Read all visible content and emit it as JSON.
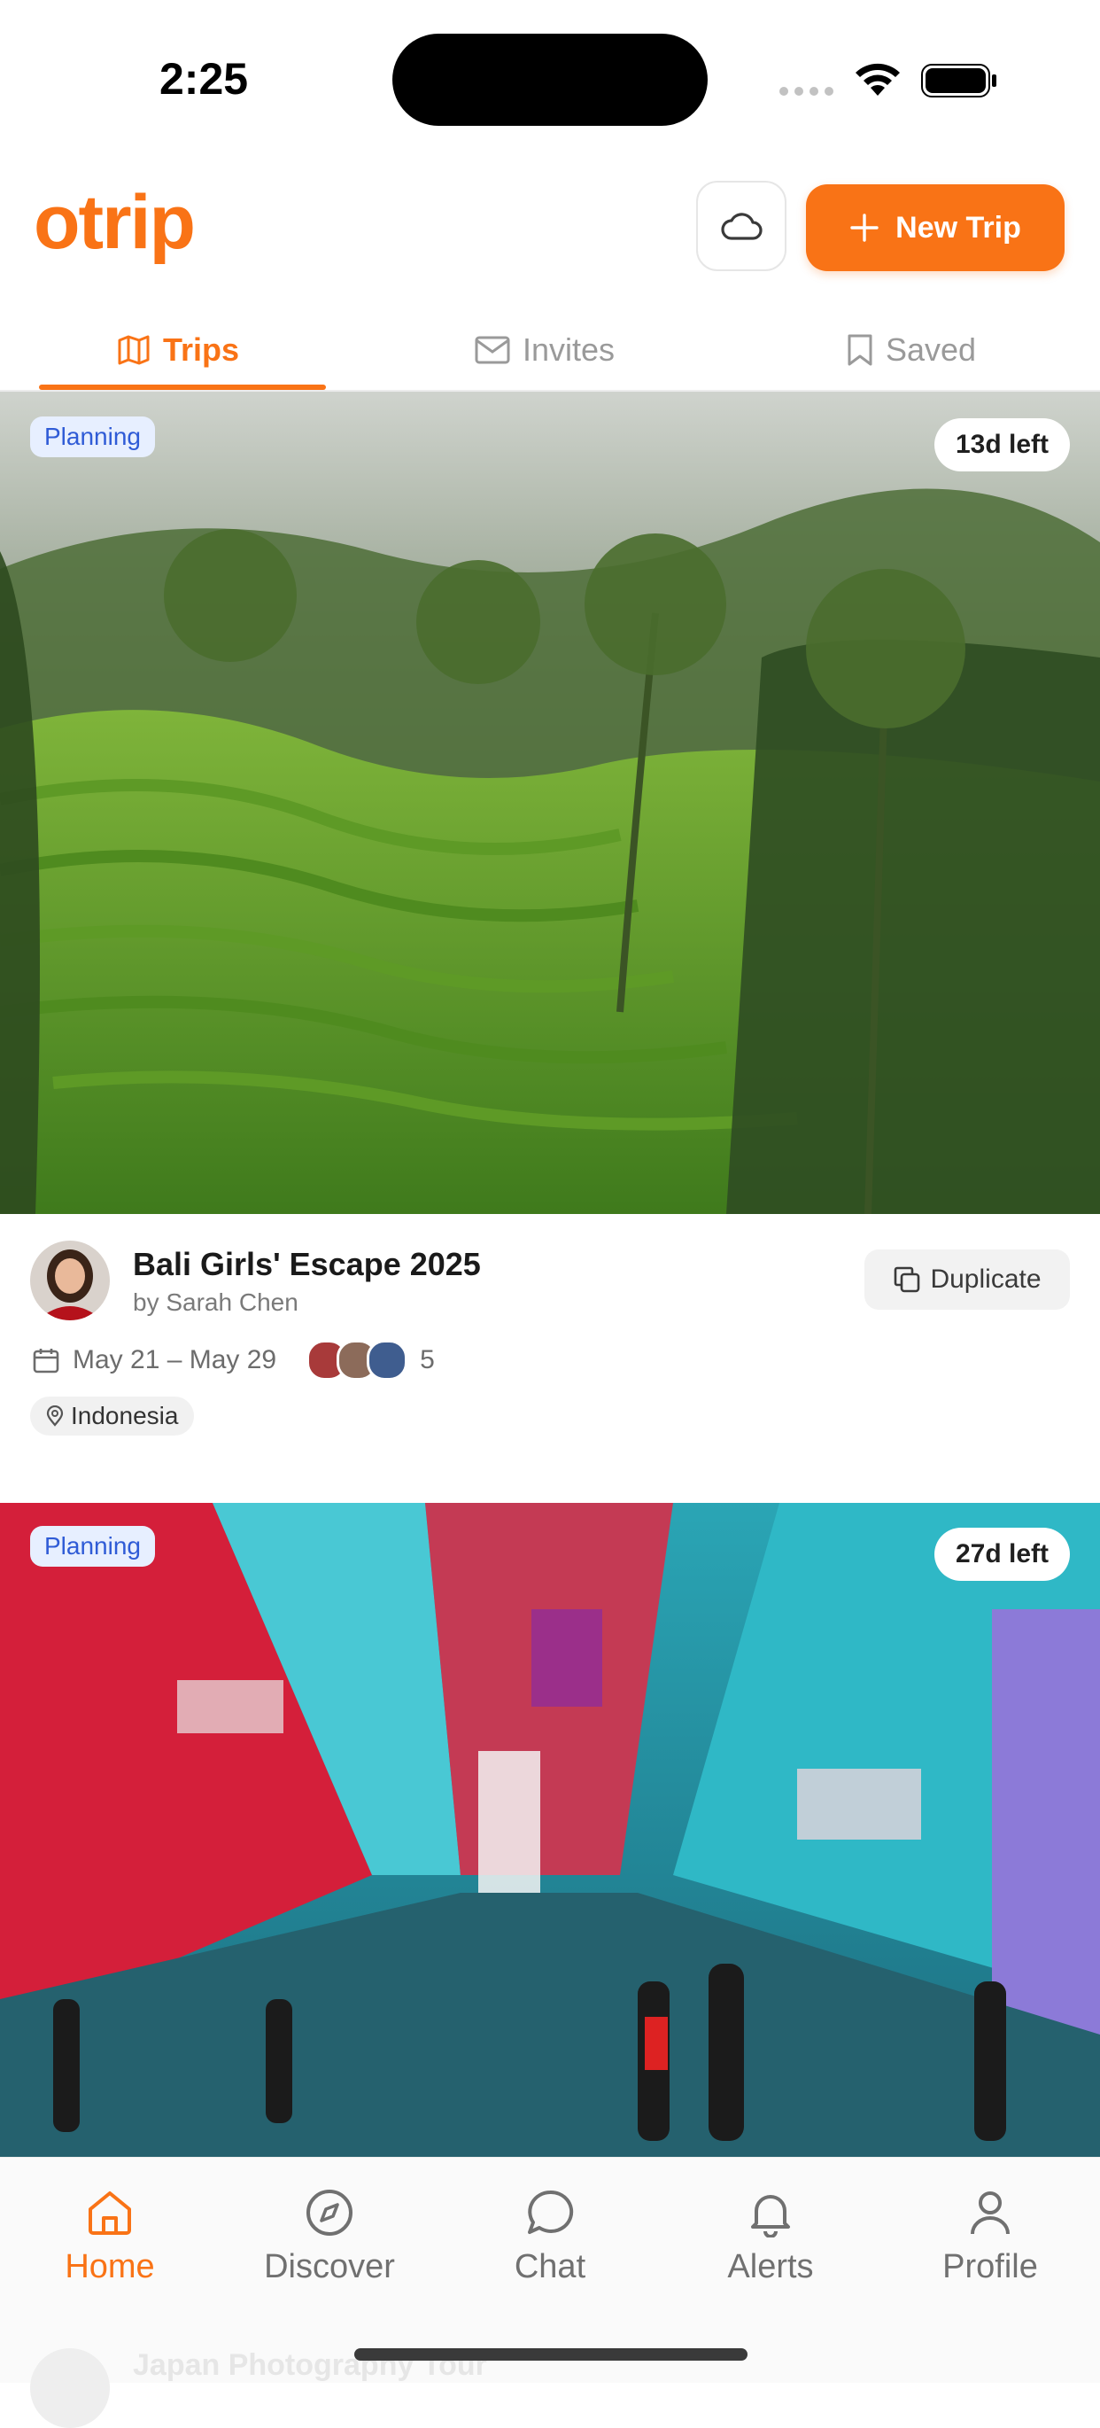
{
  "status_bar": {
    "time": "2:25"
  },
  "header": {
    "logo_text": "otrip",
    "new_trip_label": "New Trip"
  },
  "tabs": [
    {
      "label": "Trips",
      "active": true
    },
    {
      "label": "Invites",
      "active": false
    },
    {
      "label": "Saved",
      "active": false
    }
  ],
  "trips": [
    {
      "status": "Planning",
      "time_left": "13d left",
      "title": "Bali Girls' Escape 2025",
      "author": "by Sarah Chen",
      "dates": "May 21 – May 29",
      "member_count": "5",
      "location": "Indonesia",
      "duplicate_label": "Duplicate"
    },
    {
      "status": "Planning",
      "time_left": "27d left",
      "title": "Japan Photography Tour"
    }
  ],
  "bottom_nav": [
    {
      "label": "Home",
      "icon": "home-icon",
      "active": true
    },
    {
      "label": "Discover",
      "icon": "compass-icon"
    },
    {
      "label": "Chat",
      "icon": "chat-bubble-icon"
    },
    {
      "label": "Alerts",
      "icon": "bell-icon"
    },
    {
      "label": "Profile",
      "icon": "person-icon"
    }
  ],
  "colors": {
    "accent": "#f97316",
    "planning_badge_bg": "#e7efff",
    "planning_badge_text": "#2f5bd6"
  }
}
